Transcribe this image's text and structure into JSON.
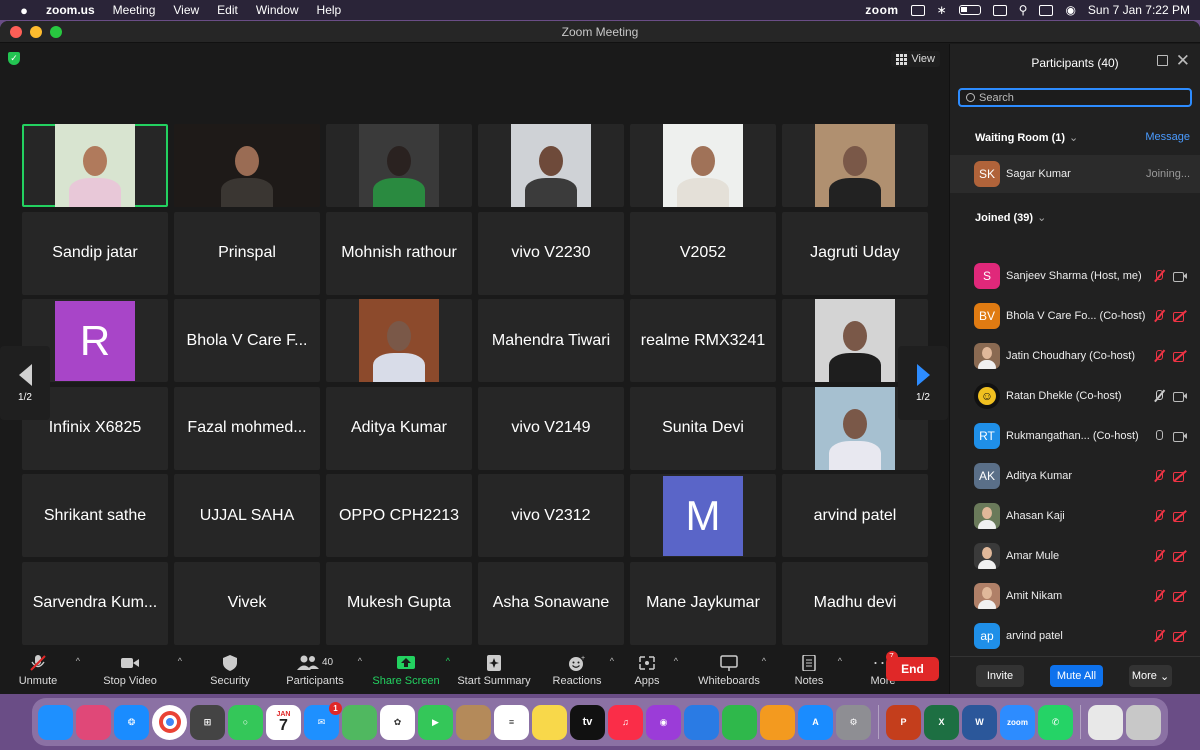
{
  "menubar": {
    "apple": "",
    "app": "zoom.us",
    "items": [
      "Meeting",
      "View",
      "Edit",
      "Window",
      "Help"
    ],
    "zoom_logo": "zoom",
    "datetime": "Sun 7 Jan  7:22 PM"
  },
  "window": {
    "title": "Zoom Meeting"
  },
  "stage": {
    "view_label": "View",
    "page_indicator_left": "1/2",
    "page_indicator_right": "1/2",
    "tiles": [
      {
        "kind": "video",
        "active": true,
        "bg": "#d8e4d0",
        "skin": "#b07a5c",
        "shirt": "#e8c8d8"
      },
      {
        "kind": "video",
        "bg": "#1e1a18",
        "skin": "#9a6c54",
        "shirt": "#3a3632",
        "wide": true
      },
      {
        "kind": "video",
        "bg": "#3a3a3a",
        "skin": "#2a2220",
        "shirt": "#2a8a40"
      },
      {
        "kind": "video",
        "bg": "#cfd2d6",
        "skin": "#6e4a3a",
        "shirt": "#3b3b3b"
      },
      {
        "kind": "video",
        "bg": "#eef0ee",
        "skin": "#a07258",
        "shirt": "#e4e0d8"
      },
      {
        "kind": "video",
        "bg": "#b09070",
        "skin": "#7a5848",
        "shirt": "#222"
      },
      {
        "kind": "name",
        "name": "Sandip jatar"
      },
      {
        "kind": "name",
        "name": "Prinspal"
      },
      {
        "kind": "name",
        "name": "Mohnish rathour"
      },
      {
        "kind": "name",
        "name": "vivo V2230"
      },
      {
        "kind": "name",
        "name": "V2052"
      },
      {
        "kind": "name",
        "name": "Jagruti Uday"
      },
      {
        "kind": "letter",
        "letter": "R",
        "color": "#a845c8"
      },
      {
        "kind": "name",
        "name": "Bhola V Care F..."
      },
      {
        "kind": "video",
        "bg": "#8c4a2c",
        "skin": "#7a5848",
        "shirt": "#d8dce8"
      },
      {
        "kind": "name",
        "name": "Mahendra Tiwari"
      },
      {
        "kind": "name",
        "name": "realme RMX3241"
      },
      {
        "kind": "video",
        "bg": "#d4d4d4",
        "skin": "#7a5848",
        "shirt": "#1e1e1e"
      },
      {
        "kind": "name",
        "name": "Infinix X6825"
      },
      {
        "kind": "name",
        "name": "Fazal mohmed..."
      },
      {
        "kind": "name",
        "name": "Aditya Kumar"
      },
      {
        "kind": "name",
        "name": "vivo V2149"
      },
      {
        "kind": "name",
        "name": "Sunita Devi"
      },
      {
        "kind": "video",
        "bg": "#a6c0d0",
        "skin": "#7a5848",
        "shirt": "#e8e8f0"
      },
      {
        "kind": "name",
        "name": "Shrikant sathe"
      },
      {
        "kind": "name",
        "name": "UJJAL SAHA"
      },
      {
        "kind": "name",
        "name": "OPPO CPH2213"
      },
      {
        "kind": "name",
        "name": "vivo V2312"
      },
      {
        "kind": "letter",
        "letter": "M",
        "color": "#5a65c8"
      },
      {
        "kind": "name",
        "name": "arvind patel"
      },
      {
        "kind": "name",
        "name": "Sarvendra Kum..."
      },
      {
        "kind": "name",
        "name": "Vivek"
      },
      {
        "kind": "name",
        "name": "Mukesh Gupta"
      },
      {
        "kind": "name",
        "name": "Asha Sonawane"
      },
      {
        "kind": "name",
        "name": "Mane Jaykumar"
      },
      {
        "kind": "name",
        "name": "Madhu devi"
      }
    ]
  },
  "toolbar": {
    "unmute": "Unmute",
    "stop_video": "Stop Video",
    "security": "Security",
    "participants": "Participants",
    "participants_count": "40",
    "share_screen": "Share Screen",
    "start_summary": "Start Summary",
    "reactions": "Reactions",
    "apps": "Apps",
    "whiteboards": "Whiteboards",
    "notes": "Notes",
    "more": "More",
    "more_badge": "7",
    "end": "End"
  },
  "panel": {
    "title": "Participants (40)",
    "search_placeholder": "Search",
    "waiting_room": "Waiting Room (1)",
    "message": "Message",
    "waiting": {
      "initials": "SK",
      "name": "Sagar Kumar",
      "status": "Joining...",
      "color": "#b0633a"
    },
    "joined": "Joined (39)",
    "participants": [
      {
        "initials": "S",
        "name": "Sanjeev Sharma (Host, me)",
        "color": "#e0287a",
        "mic": "off",
        "cam": "on"
      },
      {
        "initials": "BV",
        "name": "Bhola V Care Fo... (Co-host)",
        "color": "#e07b12",
        "mic": "off",
        "cam": "off"
      },
      {
        "initials": "",
        "name": "Jatin Choudhary (Co-host)",
        "color": "#8a6a52",
        "mic": "off",
        "cam": "off"
      },
      {
        "initials": "",
        "name": "Ratan Dhekle (Co-host)",
        "color": "#f0c020",
        "mic": "muted-gray",
        "cam": "on",
        "smiley": true
      },
      {
        "initials": "RT",
        "name": "Rukmangathan...  (Co-host)",
        "color": "#1f8fe8",
        "mic": "on",
        "cam": "on"
      },
      {
        "initials": "AK",
        "name": "Aditya Kumar",
        "color": "#5a6f88",
        "mic": "off",
        "cam": "off"
      },
      {
        "initials": "",
        "name": "Ahasan Kaji",
        "color": "#6a7a5a",
        "mic": "off",
        "cam": "off"
      },
      {
        "initials": "",
        "name": "Amar Mule",
        "color": "#3a3a3a",
        "mic": "off",
        "cam": "off"
      },
      {
        "initials": "",
        "name": "Amit Nikam",
        "color": "#b08068",
        "mic": "off",
        "cam": "off"
      },
      {
        "initials": "ap",
        "name": "arvind patel",
        "color": "#1f8fe8",
        "mic": "off",
        "cam": "off"
      }
    ],
    "invite": "Invite",
    "mute_all": "Mute All",
    "more": "More"
  },
  "dock": {
    "calendar_month": "JAN",
    "calendar_day": "7",
    "mail_badge": "1",
    "tv_label": "tv",
    "zoom_label": "zoom",
    "apps": [
      "finder",
      "launchpad",
      "safari",
      "chrome",
      "calculator",
      "messages",
      "calendar",
      "mail",
      "maps",
      "photos",
      "facetime",
      "contacts",
      "reminders",
      "notes",
      "apple-tv",
      "music",
      "podcasts",
      "keynote",
      "numbers",
      "pages",
      "app-store",
      "system-settings",
      "powerpoint",
      "excel",
      "word",
      "zoom",
      "whatsapp",
      "downloads",
      "trash"
    ]
  }
}
